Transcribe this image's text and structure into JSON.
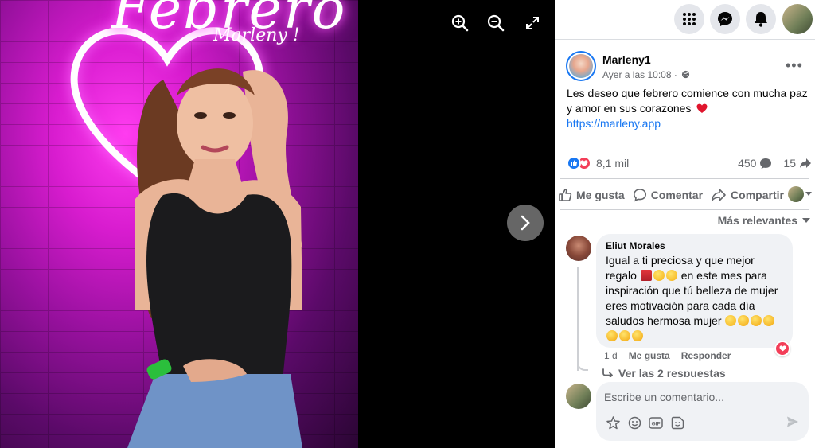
{
  "photo": {
    "neon_title": "Febrero",
    "neon_signature": "Marleny !"
  },
  "viewer_controls": [
    "zoom-in",
    "zoom-out",
    "fullscreen",
    "next"
  ],
  "topbar": {
    "icons": [
      "menu-grid-icon",
      "messenger-icon",
      "bell-icon",
      "account-avatar"
    ]
  },
  "post": {
    "author": "Marleny1",
    "time": "Ayer a las 10:08 ·",
    "text": "Les deseo que febrero comience con mucha paz y amor en sus corazones",
    "link": "https://marleny.app",
    "reaction_count": "8,1 mil",
    "comment_count": "450",
    "share_count": "15"
  },
  "actions": {
    "like": "Me gusta",
    "comment": "Comentar",
    "share": "Compartir"
  },
  "comments_sort": "Más relevantes",
  "comment": {
    "author": "Eliut Morales",
    "line1": "Igual a ti preciosa y que mejor",
    "line2": "regalo",
    "line2b": "en este mes para",
    "line3": "inspiración que tú belleza de mujer",
    "line4": "eres motivación para cada día",
    "line5": "saludos hermosa mujer",
    "age": "1 d",
    "like": "Me gusta",
    "reply": "Responder",
    "replies": "Ver las 2 respuestas"
  },
  "composer": {
    "placeholder": "Escribe un comentario..."
  },
  "colors": {
    "accent": "#1877f2",
    "heart": "#f33e58",
    "neon": "#ff2cf5"
  }
}
